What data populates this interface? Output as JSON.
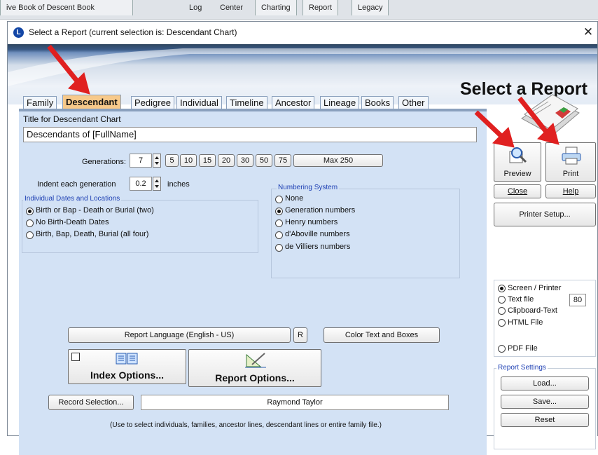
{
  "background_app": {
    "tabs": [
      "ive Book  of Descent Book",
      "Log",
      "Center",
      "Charting",
      "Report",
      "Legacy"
    ]
  },
  "dialog": {
    "title": "Select a Report  (current selection is: Descendant Chart)",
    "icon_letter": "L",
    "close_symbol": "✕",
    "banner_title": "Select a Report"
  },
  "tabs": [
    "Family",
    "Descendant",
    "Pedigree",
    "Individual",
    "Timeline",
    "Ancestor",
    "Lineage",
    "Books",
    "Other"
  ],
  "active_tab": "Descendant",
  "form": {
    "title_label": "Title for Descendant Chart",
    "title_value": "Descendants of [FullName]",
    "generations_label": "Generations:",
    "generations_value": "7",
    "generation_buttons": [
      "5",
      "10",
      "15",
      "20",
      "30",
      "50",
      "75"
    ],
    "max_button": "Max 250",
    "indent_label": "Indent each generation",
    "indent_value": "0.2",
    "indent_unit": "inches",
    "dates_group_title": "Individual Dates and Locations",
    "dates_options": [
      "Birth or Bap - Death or Burial (two)",
      "No Birth-Death Dates",
      "Birth, Bap, Death, Burial (all four)"
    ],
    "dates_selected": 0,
    "numbering_group_title": "Numbering System",
    "numbering_options": [
      "None",
      "Generation numbers",
      "Henry numbers",
      "d'Aboville numbers",
      "de Villiers numbers"
    ],
    "numbering_selected": 1,
    "report_language_button": "Report Language (English - US)",
    "r_button": "R",
    "color_button": "Color Text and Boxes",
    "index_options_button": "Index Options...",
    "report_options_button": "Report Options...",
    "record_selection_button": "Record Selection...",
    "record_selection_value": "Raymond Taylor",
    "hint": "(Use to select individuals, families, ancestor lines, descendant lines or entire family file.)"
  },
  "right": {
    "preview_label": "Preview",
    "print_label": "Print",
    "close_label": "Close",
    "help_label": "Help",
    "printer_setup_label": "Printer Setup...",
    "output_options": [
      "Screen / Printer",
      "Text file",
      "Clipboard-Text",
      "HTML File",
      "PDF File"
    ],
    "output_selected": 0,
    "text_width_value": "80",
    "report_settings_title": "Report Settings",
    "load_label": "Load...",
    "save_label": "Save...",
    "reset_label": "Reset"
  },
  "colors": {
    "panel_bg": "#d3e2f5",
    "active_tab": "#f7c98a",
    "group_title": "#1d3fb3",
    "annotation_arrow": "#e02020"
  }
}
